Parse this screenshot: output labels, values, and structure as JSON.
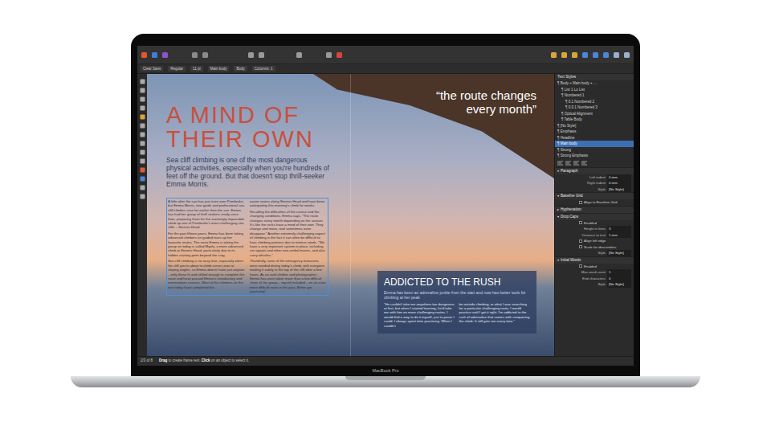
{
  "device": {
    "label": "MacBook Pro"
  },
  "context_fields": [
    "Clear Sans",
    "Regular",
    "11 pt",
    "Main body",
    "Body",
    "Columns: 1"
  ],
  "document": {
    "headline": "A MIND OF THEIR OWN",
    "standfirst": "Sea cliff climbing is one of the most dangerous physical activities, especially when you're hundreds of feet off the ground. But that doesn't stop thrill-seeker Emma Morris.",
    "columns": [
      [
        "A little after the sun has just risen over Pembroke, but Emma Morris, tour guide and professional sea cliff climber, rose far earlier than the sun. Emma has had her group of thrill seekers ready since 6am, preparing them for the seemingly impossible climb up one of Pembroke's most challenging sea cliffs – Stennis Head.",
        "For the past fifteen years, Emma has been taking advanced climbers on guided tours up her favourite routes. The route Emma is taking the group on today is called Myola, a more advanced climb at Stennis Head, particularly due to its hidden starting point beyond the crag.",
        "Sea cliff climbing is no easy feat, especially when the cliff you're about to climb curves over at sloping angles, so Emma doesn't take just anyone – only those fit and skilled enough to complete the route and have passed Emma's introductory and intermediate courses. Most of the climbers on the tour today have completed the"
      ],
      [
        "easier routes along Stennis Head and have been anticipating this morning's climb for weeks.",
        "Recalling the difficulties of the course and the changing conditions, Emma says, \"The route changes every month depending on the season. It's like the rocks have a mind of their own. They change and move, and sometimes even disappear.\" Another extremely challenging aspect of climbing is the fact it can often be difficult to hear climbing partners due to intense winds. \"We have a very important system in place, including set signals and other non-verbal moves, and also carry whistles.\"",
        "Thankfully, none of the emergency measures were needed during today's climb, with everyone making it safely to the top of the cliff after a few hours. As an avid climber and photographer, Emma has even taken more than a few difficult shots of the group – myself included – on an even more difficult route in the past. Better get practicing!"
      ]
    ],
    "pull_quote": "“the route changes every month”",
    "sidebar_box": {
      "heading": "ADDICTED TO THE RUSH",
      "intro": "Emma has been an adrenaline junkie from the start and now has better tools for climbing at her peak",
      "columns": [
        "“He couldn't take me anywhere too dangerous at first, but when I started learning, he'd take me with him on more challenging routes. I would find a way to do it myself, just to prove I could. I always spent time practicing. When I couldn't",
        "be outside climbing, or what I was searching for a particular challenging route, I would practice until I got it right. I'm addicted to the rush of adrenaline that comes with conquering the climb. It still gets me every time.”"
      ]
    }
  },
  "text_styles": {
    "title": "Text Styles",
    "items": [
      {
        "label": "Body + Main body + ...",
        "level": 0,
        "selected": false
      },
      {
        "label": "List 1 Lo List",
        "level": 1,
        "selected": false
      },
      {
        "label": "Numbered 1",
        "level": 1,
        "selected": false
      },
      {
        "label": "0.1   Numbered 2",
        "level": 2,
        "selected": false
      },
      {
        "label": "0.0.1   Numbered 3",
        "level": 2,
        "selected": false
      },
      {
        "label": "Optical Alignment",
        "level": 1,
        "selected": false
      },
      {
        "label": "Table Body",
        "level": 1,
        "selected": false
      },
      {
        "label": "[No Style]",
        "level": 0,
        "selected": false
      },
      {
        "label": "Emphasis",
        "level": 0,
        "selected": false
      },
      {
        "label": "Headline",
        "level": 0,
        "selected": false
      },
      {
        "label": "Main body",
        "level": 0,
        "selected": true
      },
      {
        "label": "Strong",
        "level": 0,
        "selected": false
      },
      {
        "label": "Strong Emphasis",
        "level": 0,
        "selected": false
      }
    ]
  },
  "paragraph_panel": [
    {
      "kind": "section",
      "label": "Paragraph",
      "expanded": true
    },
    {
      "kind": "field",
      "label": "Left indent",
      "value": "0 mm"
    },
    {
      "kind": "field",
      "label": "Right indent",
      "value": "0 mm"
    },
    {
      "kind": "field",
      "label": "Style",
      "value": "[No Style]"
    },
    {
      "kind": "section",
      "label": "Baseline Grid",
      "expanded": true
    },
    {
      "kind": "checkbox",
      "label": "Align to Baseline Grid",
      "checked": false
    },
    {
      "kind": "section",
      "label": "Hyphenation",
      "expanded": false
    },
    {
      "kind": "section",
      "label": "Drop Caps",
      "expanded": true
    },
    {
      "kind": "checkbox",
      "label": "Enabled",
      "checked": false
    },
    {
      "kind": "field",
      "label": "Height in lines",
      "value": "3"
    },
    {
      "kind": "field",
      "label": "Distance to text",
      "value": "1 mm"
    },
    {
      "kind": "checkbox",
      "label": "Align left edge",
      "checked": false
    },
    {
      "kind": "checkbox",
      "label": "Scale for descenders",
      "checked": false
    },
    {
      "kind": "field",
      "label": "Style",
      "value": "[No Style]"
    },
    {
      "kind": "section",
      "label": "Initial Words",
      "expanded": true
    },
    {
      "kind": "checkbox",
      "label": "Enabled",
      "checked": false
    },
    {
      "kind": "field",
      "label": "Max word count",
      "value": "1"
    },
    {
      "kind": "field",
      "label": "End characters",
      "value": "0"
    },
    {
      "kind": "field",
      "label": "Style",
      "value": "[No Style]"
    }
  ],
  "status_bar": {
    "page": "2/3 of 8",
    "hint": [
      {
        "text": "Drag",
        "bold": true
      },
      {
        "text": " to create frame text. ",
        "bold": false
      },
      {
        "text": "Click",
        "bold": true
      },
      {
        "text": " on an object to select it.",
        "bold": false
      }
    ]
  }
}
